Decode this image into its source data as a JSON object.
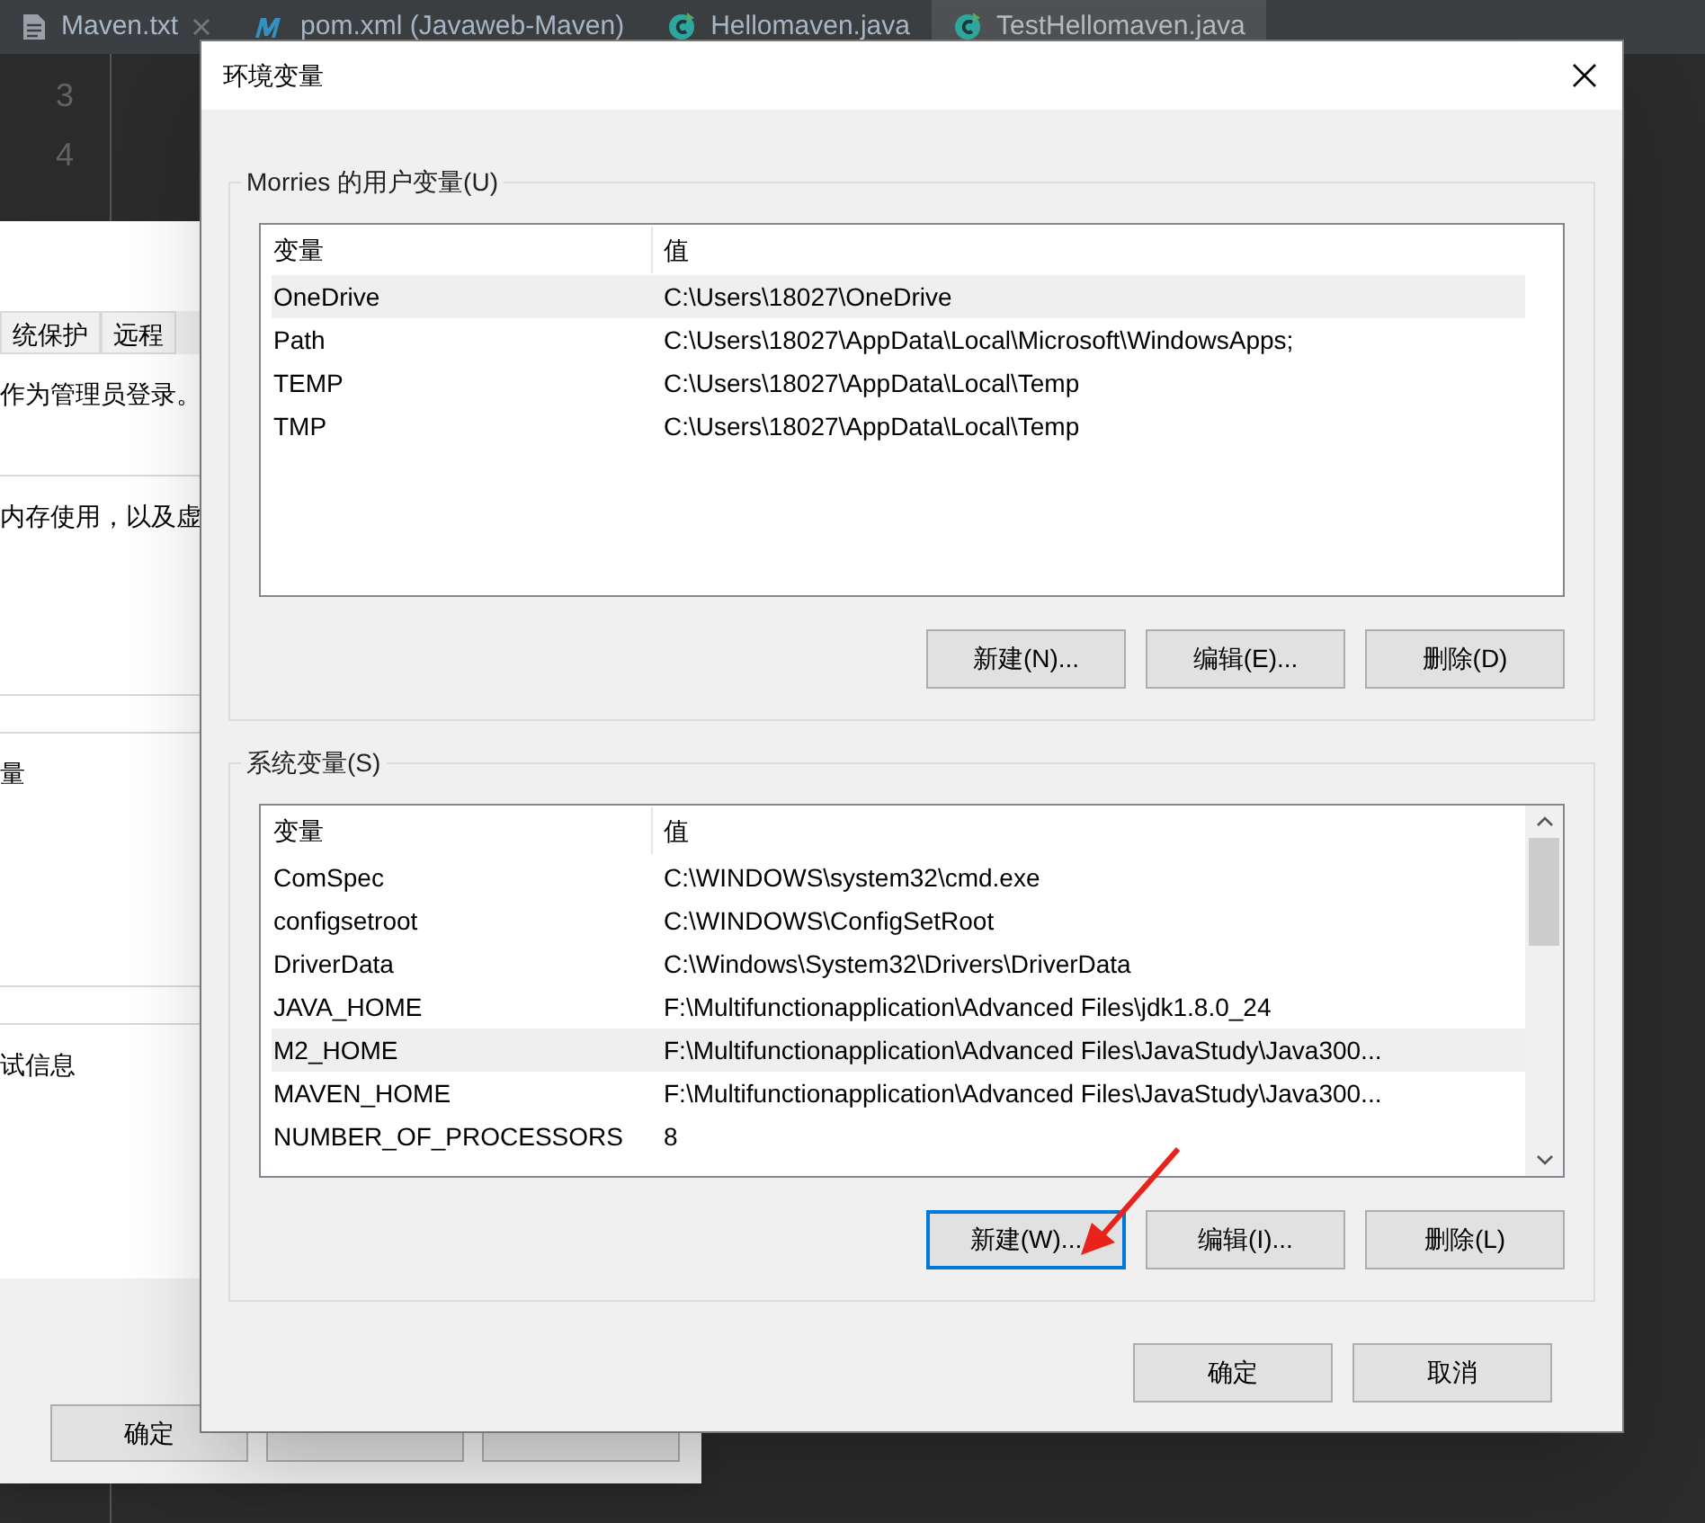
{
  "editor_tabs": [
    {
      "label": "Maven.txt",
      "kind": "text",
      "selected": false
    },
    {
      "label": "pom.xml (Javaweb-Maven)",
      "kind": "maven",
      "selected": false
    },
    {
      "label": "Hellomaven.java",
      "kind": "java",
      "selected": false
    },
    {
      "label": "TestHellomaven.java",
      "kind": "java",
      "selected": true
    }
  ],
  "line_numbers": [
    "3",
    "4"
  ],
  "system_properties": {
    "tabs": [
      {
        "label": "统保护",
        "selected": false
      },
      {
        "label": "远程",
        "selected": false
      }
    ],
    "sections": [
      "作为管理员登录。",
      "内存使用，以及虚",
      "量",
      "试信息"
    ],
    "ok_button": "确定"
  },
  "dialog": {
    "title": "环境变量",
    "user_group": {
      "legend": "Morries 的用户变量(U)",
      "columns": [
        "变量",
        "值"
      ],
      "rows": [
        {
          "name": "OneDrive",
          "value": "C:\\Users\\18027\\OneDrive",
          "selected": true
        },
        {
          "name": "Path",
          "value": "C:\\Users\\18027\\AppData\\Local\\Microsoft\\WindowsApps;",
          "selected": false
        },
        {
          "name": "TEMP",
          "value": "C:\\Users\\18027\\AppData\\Local\\Temp",
          "selected": false
        },
        {
          "name": "TMP",
          "value": "C:\\Users\\18027\\AppData\\Local\\Temp",
          "selected": false
        }
      ],
      "buttons": [
        {
          "label": "新建(N)...",
          "focused": false
        },
        {
          "label": "编辑(E)...",
          "focused": false
        },
        {
          "label": "删除(D)",
          "focused": false
        }
      ]
    },
    "system_group": {
      "legend": "系统变量(S)",
      "columns": [
        "变量",
        "值"
      ],
      "rows": [
        {
          "name": "ComSpec",
          "value": "C:\\WINDOWS\\system32\\cmd.exe",
          "selected": false
        },
        {
          "name": "configsetroot",
          "value": "C:\\WINDOWS\\ConfigSetRoot",
          "selected": false
        },
        {
          "name": "DriverData",
          "value": "C:\\Windows\\System32\\Drivers\\DriverData",
          "selected": false
        },
        {
          "name": "JAVA_HOME",
          "value": "F:\\Multifunctionapplication\\Advanced Files\\jdk1.8.0_24",
          "selected": false
        },
        {
          "name": "M2_HOME",
          "value": "F:\\Multifunctionapplication\\Advanced Files\\JavaStudy\\Java300...",
          "selected": true
        },
        {
          "name": "MAVEN_HOME",
          "value": "F:\\Multifunctionapplication\\Advanced Files\\JavaStudy\\Java300...",
          "selected": false
        },
        {
          "name": "NUMBER_OF_PROCESSORS",
          "value": "8",
          "selected": false
        }
      ],
      "buttons": [
        {
          "label": "新建(W)...",
          "focused": true
        },
        {
          "label": "编辑(I)...",
          "focused": false
        },
        {
          "label": "删除(L)",
          "focused": false
        }
      ]
    },
    "buttons": [
      "确定",
      "取消"
    ]
  }
}
